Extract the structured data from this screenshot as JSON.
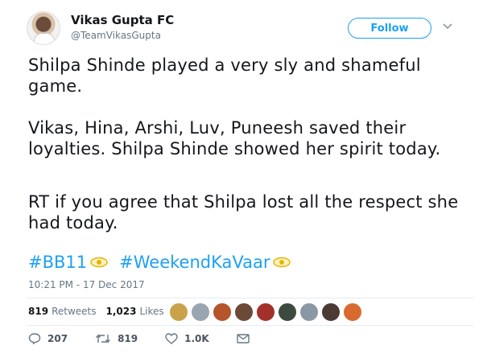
{
  "account": {
    "name": "Vikas Gupta FC",
    "handle": "@TeamVikasGupta"
  },
  "follow_label": "Follow",
  "tweet": {
    "paragraphs": [
      "Shilpa Shinde played a very sly and shameful game.",
      "Vikas, Hina, Arshi, Luv, Puneesh saved their loyalties. Shilpa Shinde showed her spirit today.",
      "RT if you agree that Shilpa lost all the respect she had today."
    ],
    "hashtags": [
      "#BB11",
      "#WeekendKaVaar"
    ],
    "timestamp": "10:21 PM - 17 Dec 2017"
  },
  "stats": {
    "retweets_count": "819",
    "retweets_label": "Retweets",
    "likes_count": "1,023",
    "likes_label": "Likes"
  },
  "likers_colors": [
    "#c9a24a",
    "#9aa5b1",
    "#b5552c",
    "#6b4a3a",
    "#a4302b",
    "#3d4a3f",
    "#8a98a6",
    "#4b3b35",
    "#d96a2f"
  ],
  "actions": {
    "reply_count": "207",
    "retweet_count": "819",
    "like_count": "1.0K"
  },
  "colors": {
    "accent": "#1da1f2",
    "secondary_text": "#657786",
    "primary_text": "#14171a"
  }
}
